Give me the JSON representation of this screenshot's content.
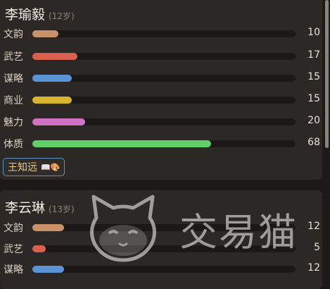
{
  "characters": [
    {
      "name": "李瑜毅",
      "age": "(12岁)",
      "stats": [
        {
          "label": "文韵",
          "value": "10",
          "fraction": 0.1,
          "color": "#c9926a"
        },
        {
          "label": "武艺",
          "value": "17",
          "fraction": 0.17,
          "color": "#d9604c"
        },
        {
          "label": "谋略",
          "value": "15",
          "fraction": 0.15,
          "color": "#5b94d6"
        },
        {
          "label": "商业",
          "value": "15",
          "fraction": 0.15,
          "color": "#d8b52e"
        },
        {
          "label": "魅力",
          "value": "20",
          "fraction": 0.2,
          "color": "#d272c2"
        },
        {
          "label": "体质",
          "value": "68",
          "fraction": 0.68,
          "color": "#5fcf6a"
        }
      ],
      "tag": {
        "label": "王知远",
        "icons": "📖🎨"
      }
    },
    {
      "name": "李云琳",
      "age": "(13岁)",
      "stats": [
        {
          "label": "文韵",
          "value": "12",
          "fraction": 0.12,
          "color": "#c9926a"
        },
        {
          "label": "武艺",
          "value": "5",
          "fraction": 0.05,
          "color": "#d9604c"
        },
        {
          "label": "谋略",
          "value": "12",
          "fraction": 0.12,
          "color": "#5b94d6"
        }
      ]
    }
  ],
  "watermark": {
    "text": "交易猫",
    "icon": "cat-logo-icon"
  },
  "colors": {
    "background": "#1c1a17",
    "card": "#2c2825",
    "track": "#1b1916",
    "tag_border": "#5a8fbf",
    "tag_text": "#e8c98a"
  }
}
